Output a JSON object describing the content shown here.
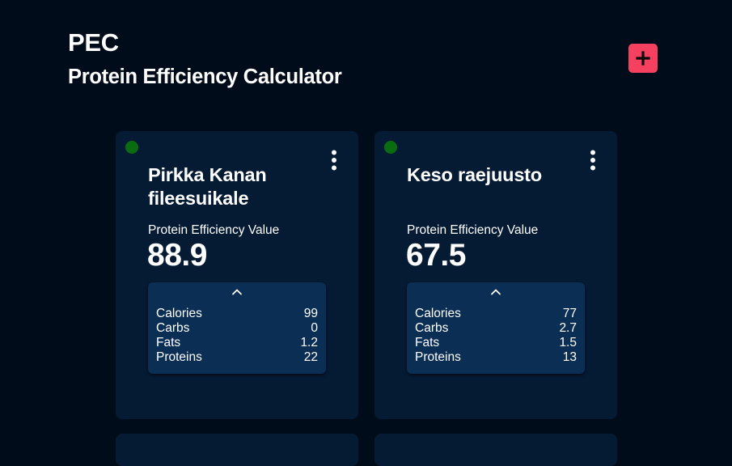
{
  "header": {
    "title": "PEC",
    "subtitle": "Protein Efficiency Calculator"
  },
  "colors": {
    "background": "#010c1b",
    "card": "#051a33",
    "panel": "#0b2e54",
    "accent": "#f5415f",
    "status": "#0a6b10"
  },
  "icons": {
    "add": "plus-icon",
    "menu": "kebab-menu-icon",
    "toggle": "chevron-up-icon",
    "status": "status-dot"
  },
  "cards": [
    {
      "name": "Pirkka Kanan fileesuikale",
      "pe_label": "Protein Efficiency Value",
      "pe_value": "88.9",
      "nutrients": [
        {
          "label": "Calories",
          "value": "99"
        },
        {
          "label": "Carbs",
          "value": "0"
        },
        {
          "label": "Fats",
          "value": "1.2"
        },
        {
          "label": "Proteins",
          "value": "22"
        }
      ]
    },
    {
      "name": "Keso raejuusto",
      "pe_label": "Protein Efficiency Value",
      "pe_value": "67.5",
      "nutrients": [
        {
          "label": "Calories",
          "value": "77"
        },
        {
          "label": "Carbs",
          "value": "2.7"
        },
        {
          "label": "Fats",
          "value": "1.5"
        },
        {
          "label": "Proteins",
          "value": "13"
        }
      ]
    }
  ]
}
